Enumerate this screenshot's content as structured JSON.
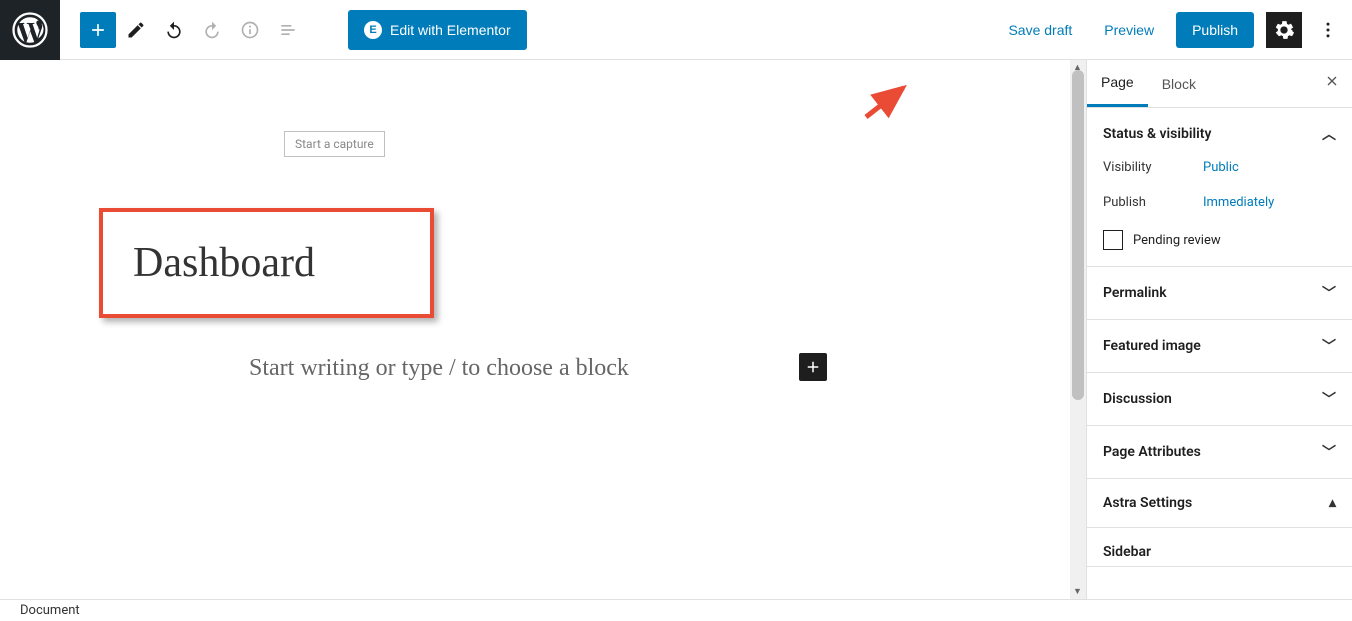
{
  "toolbar": {
    "elementor_label": "Edit with Elementor",
    "save_draft": "Save draft",
    "preview": "Preview",
    "publish": "Publish"
  },
  "editor": {
    "capture_badge": "Start a capture",
    "title": "Dashboard",
    "body_placeholder": "Start writing or type / to choose a block"
  },
  "sidebar": {
    "tabs": {
      "page": "Page",
      "block": "Block"
    },
    "status_visibility": {
      "heading": "Status & visibility",
      "visibility_label": "Visibility",
      "visibility_value": "Public",
      "publish_label": "Publish",
      "publish_value": "Immediately",
      "pending_review": "Pending review"
    },
    "panels": {
      "permalink": "Permalink",
      "featured_image": "Featured image",
      "discussion": "Discussion",
      "page_attributes": "Page Attributes",
      "astra_settings": "Astra Settings",
      "sidebar": "Sidebar"
    }
  },
  "bottombar": {
    "breadcrumb": "Document"
  }
}
